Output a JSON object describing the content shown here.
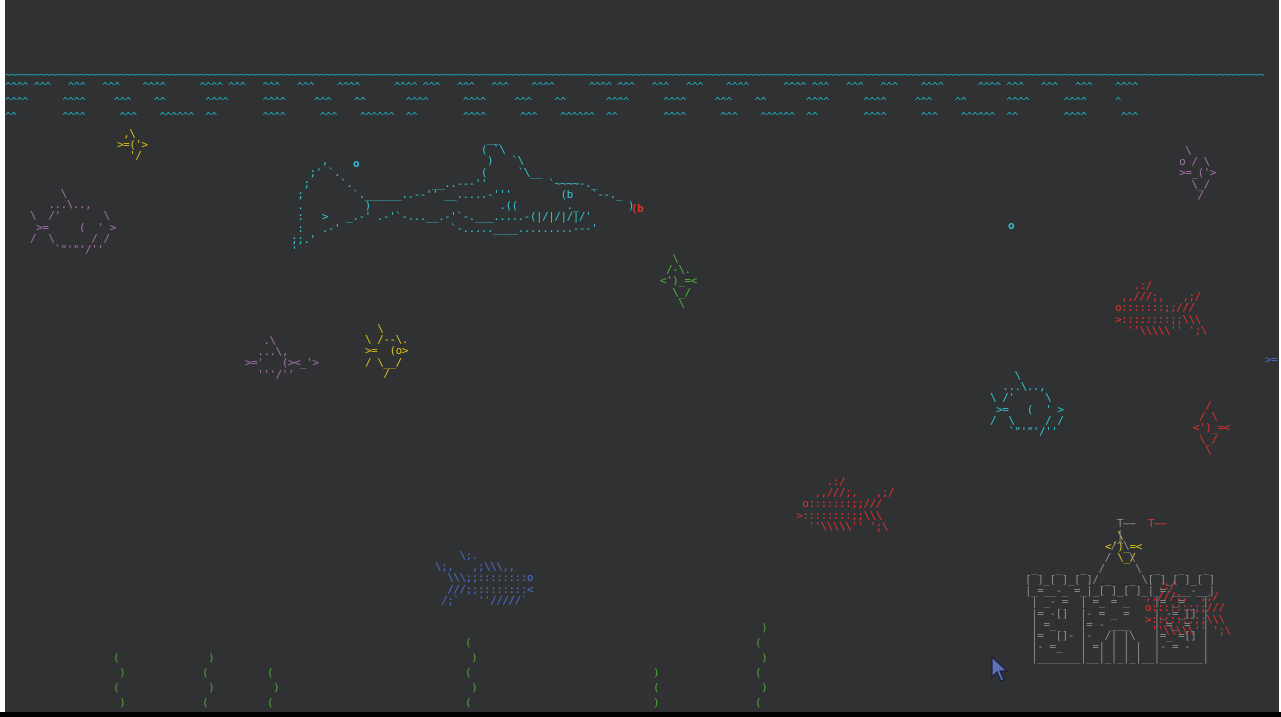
{
  "app": "asciiquarium",
  "colors": {
    "background": "#2f3133",
    "water": "#1fb3c3",
    "cyan": "#35c6d3",
    "yellow": "#d8c21c",
    "green": "#4fb43a",
    "red": "#e0322e",
    "blue": "#4a6fc8",
    "magenta": "#a472a8",
    "white": "#eeeeee",
    "gray": "#8c8c8c",
    "seaweed": "#4fa63a"
  },
  "surface": {
    "line1": "~~~~~~~~~~~~~~~~~~~~~~~~~~~~~~~~~~~~~~~~~~~~~~~~~~~~~~~~~~~~~~~~~~~~~~~~~~~~~~~~~~~~~~~~~~~~~~~~~~~~~~~~~~~~~~~~~~~~~~~~~~~~~~~~~~~~~~~~~~~~~~~~~~~~~~~~~~~~~~~~~~~~~~~~~~~~~~~~~~~~~~~~~~~~~~~~~~~~~~~~~~~~~~~~~~~~~~~~~~~~",
    "line2": "^^^^ ^^^   ^^^   ^^^    ^^^^      ^^^^ ^^^   ^^^   ^^^    ^^^^      ^^^^ ^^^   ^^^   ^^^    ^^^^      ^^^^ ^^^   ^^^   ^^^    ^^^^      ^^^^ ^^^   ^^^   ^^^    ^^^^      ^^^^ ^^^   ^^^   ^^^    ^^^^",
    "line3": "^^^^      ^^^^     ^^^    ^^       ^^^^      ^^^^     ^^^    ^^       ^^^^      ^^^^     ^^^    ^^       ^^^^      ^^^^     ^^^    ^^       ^^^^      ^^^^     ^^^    ^^       ^^^^      ^^^^     ^",
    "line4": "^^        ^^^^      ^^^    ^^^^^^  ^^        ^^^^      ^^^    ^^^^^^  ^^        ^^^^      ^^^    ^^^^^^  ^^        ^^^^      ^^^    ^^^^^^  ^^        ^^^^      ^^^    ^^^^^^  ^^        ^^^^      ^^^"
  },
  "shark": {
    "fin": "                                 __\n                                ( `\\\n      ,                          )   `\\\n    ;' `.                       (     `\\__\n   ;     `.             __..---''          `~~~~-._\n  ;        `.______..--'' __.....-'''        (b   `--._\n  .          )                     .((        ._        )\n  :   >   _.-' .-'`-...__.-'`-.___.....-(|/|/|/|/'\n  :   .-'                  `-.....____.........---'\n ;;.'\n '",
    "eye": "(b",
    "teeth": "|/|/|/|/'"
  },
  "fish": {
    "f1_body": " ,\\\n>=('>\n  '/",
    "f2_body": "     \\\n   ...\\..,\n\\  /'       \\\n >=     (  ' >\n/  \\      / /\n    `\"'\"'/''",
    "f3_body": "    \\\n  ...\\..,\n\\ /'     \\\n >=   (  ' >\n/  \\     / /\n   `\"'\"'/''",
    "f4_body": "  \\\n /-\\.\n<')_=<\n  \\_/\n   \\",
    "f5_body": "   .\\\n  ...\\,\n>='   (><_'>\n  '''/''",
    "f6_body": "  \\\n\\ /--\\.\n>=  (o>\n/ \\__/\n   /",
    "f7_body": "  \\\n o / \\\n >=_('>\n   \\_/\n    /",
    "f8_body": "   .:/\n ,,///;,   ,;/\no:::::::;;///\n>::::::::;;\\\\\\\n  ''\\\\\\\\\\'' ';\\",
    "f9_body": "      .:/\n    ,,///;,   ,;/\n  o:::::::;;///\n >::::::::;;\\\\\\\n   ''\\\\\\\\\\'' ';\\",
    "f10_body": "    \\;.\n\\;,   ,;\\\\\\,,\n  \\\\\\;;::::::::o\n  ///;;::::::::<\n /;`   ''/////`",
    "f11_body": "  \\\n<')_=<\n  \\_/",
    "f12_body": " <')_=<\n   \\_/\n    \\",
    "f13_body": "  .:/\n,,///;,  ,;/\no:::::::;;///\n>:::::::;;\\\\\\\n ''\\\\\\\\\\'' ';\\",
    "f14_body": ">=",
    "f15_body": "  /\n / \\\n<')_=<\n \\_/\n  \\"
  },
  "bubbles": {
    "b1": "o",
    "b2": "o"
  },
  "castle": {
    "flag": "T~~",
    "art": "               T~~\n               |\n              /^\\\n             /   \\\n _   _   _  /     \\  _   _   _\n[ ]_[ ]_[ ]/ _   _ \\[ ]_[ ]_[ ]\n|_=__-_ =_|_[ ]_[ ]_|_=-___-__|\n | _- =  | =_ = _    |= _=   |\n |= -[]  |- = _ =    |_-=_[] |\n | =_    |= - ___    | =_ =  |\n |=  []- |-  /| |\\   |=_ =[] |\n |- =_   | =| | | |  |- = -  |\n |_______|__|_|_|_|__|_______|"
  },
  "seaweed": {
    "s1": "(\n )\n(\n )",
    "s2": " )\n(\n )\n(",
    "s3": "(\n )\n(",
    "s4": "(\n )\n(\n )\n(\n )",
    "s5": ")\n(\n)\n(",
    "s6": " )\n(\n )\n(\n )\n(\n )"
  }
}
